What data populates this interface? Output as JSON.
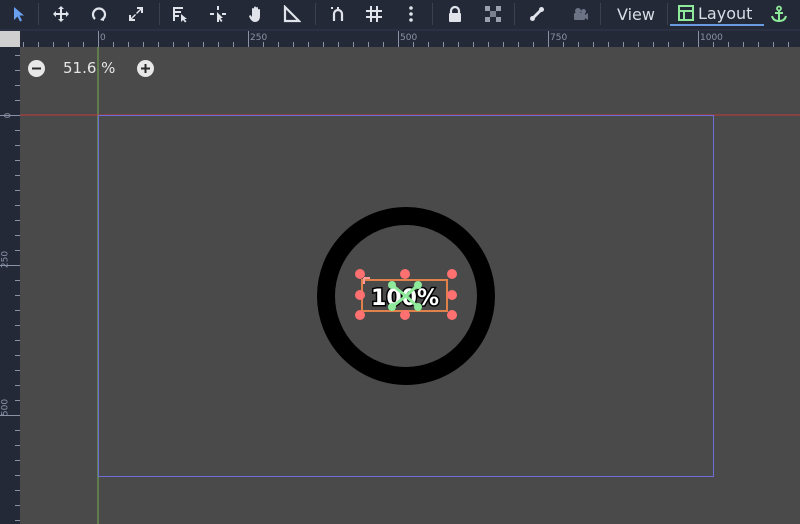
{
  "toolbar": {
    "tools": [
      {
        "name": "select-tool-icon",
        "active": true
      },
      {
        "name": "move-tool-icon"
      },
      {
        "name": "rotate-tool-icon"
      },
      {
        "name": "scale-tool-icon"
      },
      {
        "name": "list-select-icon"
      },
      {
        "name": "pivot-tool-icon"
      },
      {
        "name": "pan-tool-icon"
      },
      {
        "name": "ruler-tool-icon"
      },
      {
        "name": "smart-snap-icon"
      },
      {
        "name": "grid-snap-icon"
      },
      {
        "name": "more-options-icon"
      },
      {
        "name": "lock-icon"
      },
      {
        "name": "group-icon"
      },
      {
        "name": "bone-icon"
      },
      {
        "name": "camera-icon"
      }
    ],
    "view_label": "View",
    "layout_label": "Layout",
    "accent_color": "#6a9be0",
    "anchor_color": "#8eea9a"
  },
  "rulers": {
    "top_labels": [
      "0",
      "250",
      "500",
      "750",
      "1000"
    ],
    "left_labels": [
      "0",
      "250",
      "500"
    ]
  },
  "zoom": {
    "value": "51.6 %"
  },
  "canvas": {
    "label_text": "100%",
    "ring_color": "#000000",
    "viewport_color": "#6e6ed8",
    "handle_color": "#ff7070",
    "selection_color": "#e0804a",
    "anchor_color": "#8eea9a"
  }
}
